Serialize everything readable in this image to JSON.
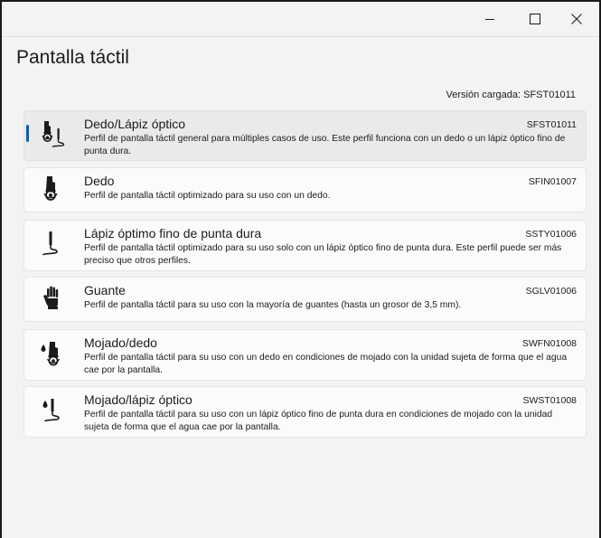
{
  "window": {
    "controls": {
      "minimize_icon": "minimize-icon",
      "maximize_icon": "maximize-icon",
      "close_icon": "close-icon"
    }
  },
  "page": {
    "title": "Pantalla táctil",
    "version_label": "Versión cargada: SFST01011"
  },
  "colors": {
    "accent": "#005fb8",
    "window_bg": "#f3f3f3",
    "card_bg": "#fbfbfb",
    "selected_card_bg": "#eaeaea"
  },
  "profiles": [
    {
      "name": "Dedo/Lápiz óptico",
      "code": "SFST01011",
      "description": "Perfil de pantalla táctil general para múltiples casos de uso. Este perfil funciona con un dedo o un lápiz óptico fino de punta dura.",
      "icon": "finger-and-stylus-icon",
      "selected": true
    },
    {
      "name": "Dedo",
      "code": "SFIN01007",
      "description": "Perfil de pantalla táctil optimizado para su uso con un dedo.",
      "icon": "finger-touch-icon",
      "selected": false
    },
    {
      "name": "Lápiz óptimo fino de punta dura",
      "code": "SSTY01006",
      "description": "Perfil de pantalla táctil optimizado para su uso solo con un lápiz óptico fino de punta dura. Este perfil puede ser más preciso que otros perfiles.",
      "icon": "stylus-icon",
      "selected": false
    },
    {
      "name": "Guante",
      "code": "SGLV01006",
      "description": "Perfil de pantalla táctil para su uso con la mayoría de guantes (hasta un grosor de 3,5 mm).",
      "icon": "glove-icon",
      "selected": false
    },
    {
      "name": "Mojado/dedo",
      "code": "SWFN01008",
      "description": "Perfil de pantalla táctil para su uso con un dedo en condiciones de mojado con la unidad sujeta de forma que el agua cae por la pantalla.",
      "icon": "wet-finger-icon",
      "selected": false
    },
    {
      "name": "Mojado/lápiz óptico",
      "code": "SWST01008",
      "description": "Perfil de pantalla táctil para su uso con un lápiz óptico fino de punta dura en condiciones de mojado con la unidad sujeta de forma que el agua cae por la pantalla.",
      "icon": "wet-stylus-icon",
      "selected": false
    }
  ]
}
